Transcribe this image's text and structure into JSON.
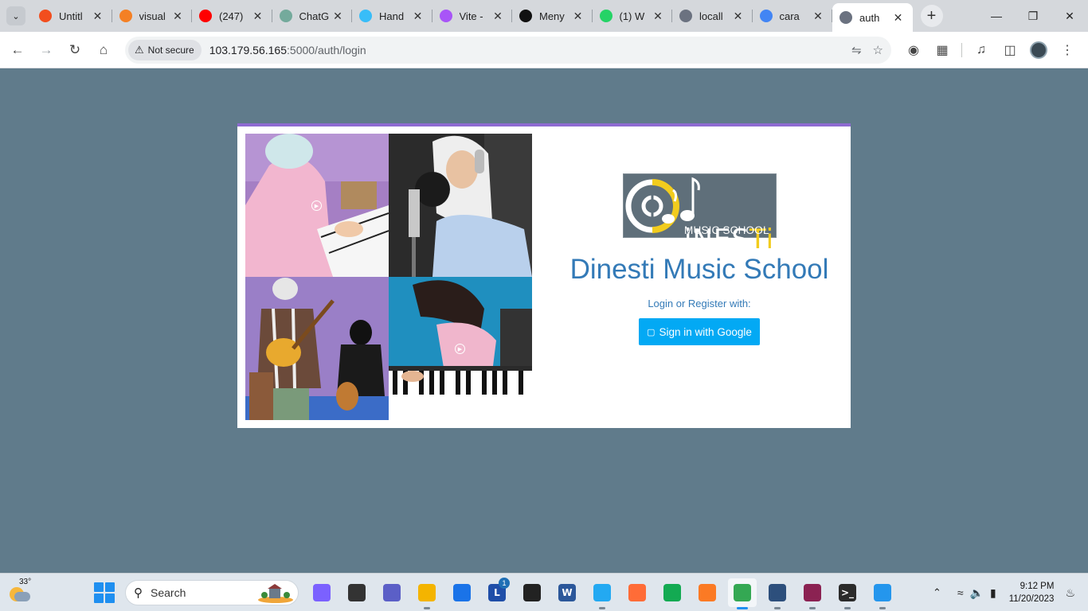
{
  "browser": {
    "tabs": [
      {
        "title": "Untitl",
        "icon": "figma-icon",
        "color": "#f24e1e",
        "active": false
      },
      {
        "title": "visual",
        "icon": "stackoverflow-icon",
        "color": "#f48024",
        "active": false
      },
      {
        "title": "(247)",
        "icon": "youtube-icon",
        "color": "#ff0000",
        "active": false
      },
      {
        "title": "ChatG",
        "icon": "chatgpt-icon",
        "color": "#74aa9c",
        "active": false
      },
      {
        "title": "Hand",
        "icon": "tailwind-icon",
        "color": "#38bdf8",
        "active": false
      },
      {
        "title": "Vite -",
        "icon": "vite-icon",
        "color": "#a855f7",
        "active": false
      },
      {
        "title": "Meny",
        "icon": "medium-icon",
        "color": "#111111",
        "active": false
      },
      {
        "title": "(1) W",
        "icon": "whatsapp-icon",
        "color": "#25d366",
        "active": false
      },
      {
        "title": "locall",
        "icon": "globe-icon",
        "color": "#6b7280",
        "active": false
      },
      {
        "title": "cara",
        "icon": "google-icon",
        "color": "#4285f4",
        "active": false
      },
      {
        "title": "auth",
        "icon": "globe-icon",
        "color": "#6b7280",
        "active": true
      }
    ],
    "security_label": "Not secure",
    "url_host": "103.179.56.165",
    "url_path": ":5000/auth/login"
  },
  "page": {
    "logo_word_main": "iNES",
    "logo_word_accent": "Ti",
    "logo_subtitle": "MUSIC SCHOOL",
    "title": "Dinesti Music School",
    "prompt": "Login or Register with:",
    "google_button_label": "Sign in with Google",
    "accent_color": "#8e6bd1",
    "brand_blue": "#337ab7",
    "button_color": "#03a9f4"
  },
  "taskbar": {
    "weather_temp": "33°",
    "search_label": "Search",
    "apps": [
      {
        "name": "copilot",
        "glyph": "",
        "color": "#7b61ff",
        "badge": ""
      },
      {
        "name": "task-view",
        "glyph": "",
        "color": "#333333",
        "badge": ""
      },
      {
        "name": "teams-meet",
        "glyph": "",
        "color": "#5b5fc7",
        "badge": ""
      },
      {
        "name": "file-explorer",
        "glyph": "",
        "color": "#f4b400",
        "badge": ""
      },
      {
        "name": "microsoft-store",
        "glyph": "",
        "color": "#1a73e8",
        "badge": ""
      },
      {
        "name": "l-app",
        "glyph": "L",
        "color": "#1f4ea8",
        "badge": "1"
      },
      {
        "name": "sticky-notes",
        "glyph": "",
        "color": "#222222",
        "badge": ""
      },
      {
        "name": "word",
        "glyph": "W",
        "color": "#2b579a",
        "badge": ""
      },
      {
        "name": "vscode",
        "glyph": "",
        "color": "#23a9f2",
        "badge": ""
      },
      {
        "name": "postman",
        "glyph": "",
        "color": "#ff6c37",
        "badge": ""
      },
      {
        "name": "mongodb-compass",
        "glyph": "",
        "color": "#13aa52",
        "badge": ""
      },
      {
        "name": "xampp",
        "glyph": "",
        "color": "#fb7a24",
        "badge": ""
      },
      {
        "name": "chrome",
        "glyph": "",
        "color": "#34a853",
        "badge": ""
      },
      {
        "name": "mysql-workbench",
        "glyph": "",
        "color": "#2d4f7c",
        "badge": ""
      },
      {
        "name": "winrar",
        "glyph": "",
        "color": "#8b2252",
        "badge": ""
      },
      {
        "name": "terminal",
        "glyph": ">_",
        "color": "#2b2b2b",
        "badge": ""
      },
      {
        "name": "docker",
        "glyph": "",
        "color": "#2496ed",
        "badge": ""
      }
    ],
    "time": "9:12 PM",
    "date": "11/20/2023"
  }
}
